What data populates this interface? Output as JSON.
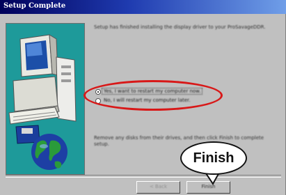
{
  "window": {
    "title": "Setup Complete"
  },
  "main": {
    "intro_text": "Setup has finished installing the display driver to your ProSavageDDR.",
    "radio_options": [
      {
        "label": "Yes, I want to restart my computer now.",
        "selected": true
      },
      {
        "label": "No, I will restart my computer later.",
        "selected": false
      }
    ],
    "instruction_text_line1": "Remove any disks from their drives, and then click Finish to complete",
    "instruction_text_line2": "setup."
  },
  "buttons": {
    "back_label": "< Back",
    "finish_label": "Finish"
  },
  "annotation": {
    "callout_label": "Finish",
    "highlight_color": "#d81818"
  },
  "colors": {
    "title_bar_start": "#00005a",
    "title_bar_end": "#6f9ee8",
    "panel": "#1e9a9a"
  }
}
